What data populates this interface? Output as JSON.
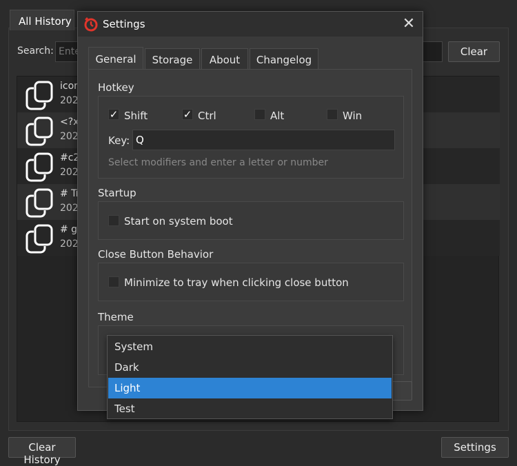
{
  "main": {
    "tab_label": "All History",
    "search_label": "Search:",
    "search_placeholder": "Ente",
    "clear_label": "Clear",
    "clear_history_label": "Clear History",
    "settings_label": "Settings",
    "history": [
      {
        "title": "icon",
        "date": "202"
      },
      {
        "title": "<?xr",
        "date": "202"
      },
      {
        "title": "#c2",
        "date": "202"
      },
      {
        "title": "# Tr",
        "date": "202"
      },
      {
        "title": "# ge",
        "date": "202"
      }
    ]
  },
  "dialog": {
    "title": "Settings",
    "close_glyph": "✕",
    "tabs": [
      "General",
      "Storage",
      "About",
      "Changelog"
    ],
    "active_tab": "General",
    "hotkey": {
      "label": "Hotkey",
      "modifiers": [
        {
          "label": "Shift",
          "checked": true
        },
        {
          "label": "Ctrl",
          "checked": true
        },
        {
          "label": "Alt",
          "checked": false
        },
        {
          "label": "Win",
          "checked": false
        }
      ],
      "key_label": "Key:",
      "key_value": "Q",
      "hint": "Select modifiers and enter a letter or number"
    },
    "startup": {
      "label": "Startup",
      "option_label": "Start on system boot",
      "checked": false
    },
    "close_behavior": {
      "label": "Close Button Behavior",
      "option_label": "Minimize to tray when clicking close button",
      "checked": false
    },
    "theme": {
      "label": "Theme",
      "options": [
        "System",
        "Dark",
        "Light",
        "Test"
      ],
      "highlighted": "Light"
    }
  },
  "colors": {
    "accent": "#2d83d4",
    "logo_red": "#e0352b",
    "background": "#2b2b2b"
  },
  "icons": {
    "history_item": "copy-icon",
    "app_logo": "stopwatch-logo-icon",
    "checkmark": "check-icon",
    "close": "close-icon"
  }
}
